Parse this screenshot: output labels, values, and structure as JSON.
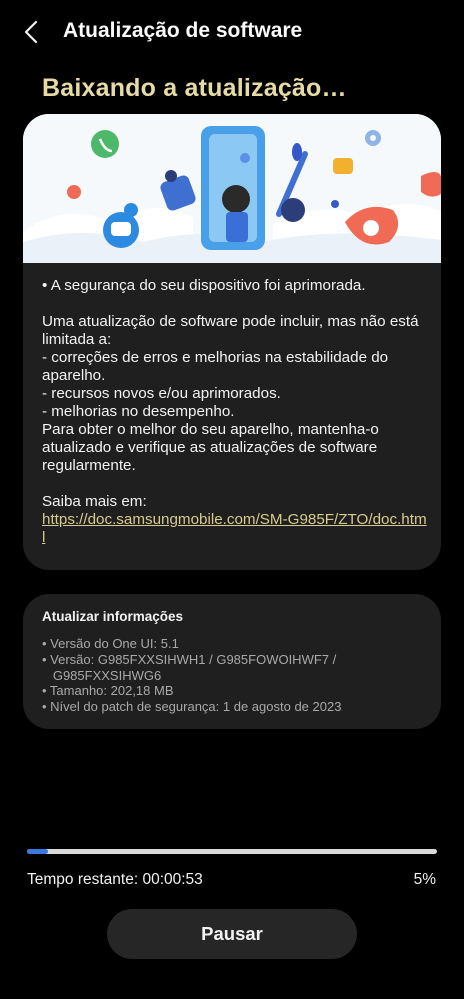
{
  "header": {
    "title": "Atualização de software",
    "back_icon": "chevron-left-icon"
  },
  "status_heading": "Baixando a atualização…",
  "info_card": {
    "security_line": "• A segurança do seu dispositivo foi aprimorada.",
    "intro": "Uma atualização de software pode incluir, mas não está limitada a:",
    "items": [
      " - correções de erros e melhorias na estabilidade do aparelho.",
      " - recursos novos e/ou aprimorados.",
      " - melhorias no desempenho."
    ],
    "advice": "Para obter o melhor do seu aparelho, mantenha-o atualizado e verifique as atualizações de software regularmente.",
    "learn_more_label": "Saiba mais em:",
    "learn_more_url": "https://doc.samsungmobile.com/SM-G985F/ZTO/doc.html"
  },
  "update_info": {
    "title": "Atualizar informações",
    "lines": [
      "• Versão do One UI: 5.1",
      "• Versão: G985FXXSIHWH1 / G985FOWOIHWF7 /",
      "   G985FXXSIHWG6",
      "• Tamanho: 202,18 MB",
      "• Nível do patch de segurança: 1 de agosto de 2023"
    ]
  },
  "progress": {
    "fraction": 0.05,
    "percent_label": "5%",
    "time_label": "Tempo restante: 00:00:53",
    "accent_color": "#3c78e4"
  },
  "pause_button": {
    "label": "Pausar"
  },
  "colors": {
    "heading_gold": "#e6dba5",
    "link_gold": "#d8cb8e",
    "card_bg": "#1f1f1f"
  }
}
